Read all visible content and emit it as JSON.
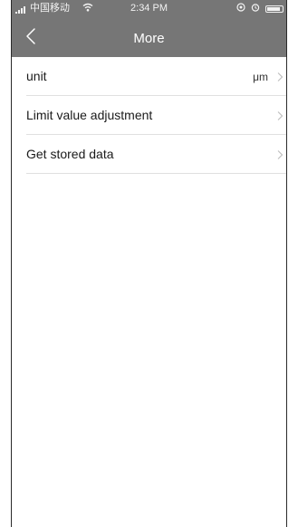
{
  "status_bar": {
    "carrier": "中国移动",
    "time": "2:34 PM"
  },
  "nav": {
    "title": "More",
    "back_icon": "chevron-left-icon"
  },
  "settings": [
    {
      "label": "unit",
      "value": "μm"
    },
    {
      "label": "Limit value adjustment",
      "value": ""
    },
    {
      "label": "Get stored data",
      "value": ""
    }
  ],
  "colors": {
    "header_bg": "#767676",
    "header_text": "#ffffff",
    "divider": "#e0e0e0",
    "chevron": "#bdbdbd"
  }
}
